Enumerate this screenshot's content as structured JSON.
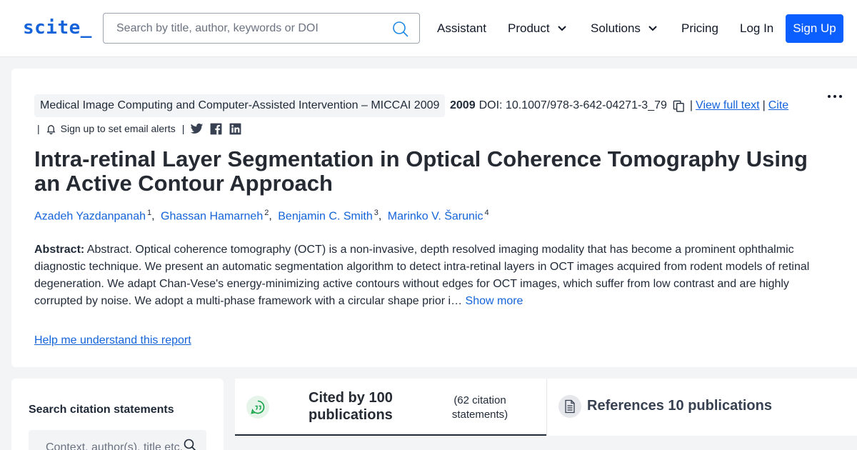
{
  "header": {
    "logo": "scite_",
    "search_placeholder": "Search by title, author, keywords or DOI",
    "nav": {
      "assistant": "Assistant",
      "product": "Product",
      "solutions": "Solutions",
      "pricing": "Pricing",
      "login": "Log In",
      "signup": "Sign Up"
    }
  },
  "paper": {
    "venue": "Medical Image Computing and Computer-Assisted Intervention – MICCAI 2009",
    "year": "2009",
    "doi": "DOI: 10.1007/978-3-642-04271-3_79",
    "sep1": "|",
    "view_full_text": "View full text",
    "sep2": "|",
    "cite": "Cite",
    "alert_bar": "|",
    "alert_text": "Sign up to set email alerts",
    "alert_bar2": "|",
    "title": "Intra-retinal Layer Segmentation in Optical Coherence Tomography Using an Active Contour Approach",
    "authors": [
      {
        "name": "Azadeh Yazdanpanah",
        "sup": "1"
      },
      {
        "name": "Ghassan Hamarneh",
        "sup": "2"
      },
      {
        "name": "Benjamin C. Smith",
        "sup": "3"
      },
      {
        "name": "Marinko V. Šarunic",
        "sup": "4"
      }
    ],
    "author_sep": ",",
    "abstract_label": "Abstract:",
    "abstract_text": "Abstract. Optical coherence tomography (OCT) is a non-invasive, depth resolved imaging modality that has become a prominent ophthalmic diagnostic technique. We present an automatic segmentation algorithm to detect intra-retinal layers in OCT images acquired from rodent models of retinal degeneration. We adapt Chan-Vese's energy-minimizing active contours without edges for OCT images, which suffer from low contrast and are highly corrupted by noise. We adopt a multi-phase framework with a circular shape prior i…",
    "show_more": "Show more",
    "help_link": "Help me understand this report"
  },
  "sidebar": {
    "title": "Search citation statements",
    "placeholder": "Context, author(s), title etc."
  },
  "tabs": {
    "cited_by": "Cited by 100 publications",
    "cited_sub": "(62 citation statements)",
    "references": "References 10 publications"
  },
  "colors": {
    "accent": "#0b5fff",
    "link": "#1463d9"
  }
}
